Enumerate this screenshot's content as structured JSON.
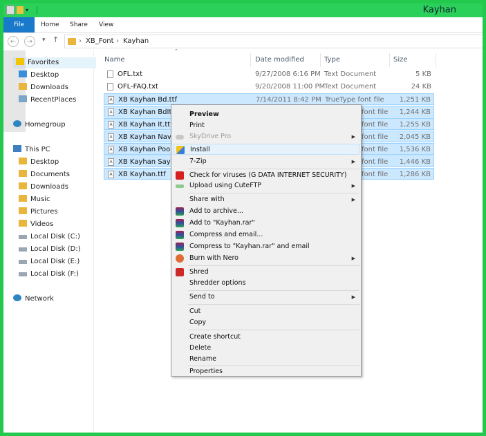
{
  "window": {
    "title": "Kayhan"
  },
  "ribbon": {
    "file": "File",
    "home": "Home",
    "share": "Share",
    "view": "View"
  },
  "address": {
    "part1": "XB_Font",
    "part2": "Kayhan",
    "sep": "›"
  },
  "sidebar": {
    "favorites": "Favorites",
    "desktop": "Desktop",
    "downloads": "Downloads",
    "recent": "RecentPlaces",
    "homegroup": "Homegroup",
    "thispc": "This PC",
    "pc_desktop": "Desktop",
    "documents": "Documents",
    "pc_downloads": "Downloads",
    "music": "Music",
    "pictures": "Pictures",
    "videos": "Videos",
    "disk_c": "Local Disk (C:)",
    "disk_d": "Local Disk (D:)",
    "disk_e": "Local Disk (E:)",
    "disk_f": "Local Disk (F:)",
    "network": "Network"
  },
  "columns": {
    "name": "Name",
    "date": "Date modified",
    "type": "Type",
    "size": "Size"
  },
  "files": [
    {
      "name": "OFL.txt",
      "date": "9/27/2008 6:16 PM",
      "type": "Text Document",
      "size": "5 KB"
    },
    {
      "name": "OFL-FAQ.txt",
      "date": "9/20/2008 11:00 PM",
      "type": "Text Document",
      "size": "24 KB"
    },
    {
      "name": "XB Kayhan Bd.ttf",
      "date": "7/14/2011 8:42 PM",
      "type": "TrueType font file",
      "size": "1,251 KB"
    },
    {
      "name": "XB Kayhan BdIt.ttf",
      "type": "font file",
      "size": "1,244 KB"
    },
    {
      "name": "XB Kayhan It.ttf",
      "type": "font file",
      "size": "1,255 KB"
    },
    {
      "name": "XB Kayhan Navaar",
      "type": "font file",
      "size": "2,045 KB"
    },
    {
      "name": "XB Kayhan Pook.tt",
      "type": "font file",
      "size": "1,536 KB"
    },
    {
      "name": "XB Kayhan Sayeh.",
      "type": "font file",
      "size": "1,446 KB"
    },
    {
      "name": "XB Kayhan.ttf",
      "type": "font file",
      "size": "1,286 KB"
    }
  ],
  "menu": {
    "preview": "Preview",
    "print": "Print",
    "skydrive": "SkyDrive Pro",
    "install": "Install",
    "zip": "7-Zip",
    "scan": "Check for viruses (G DATA INTERNET SECURITY)",
    "cuteftp": "Upload using CuteFTP",
    "share": "Share with",
    "archive": "Add to archive...",
    "rar": "Add to \"Kayhan.rar\"",
    "compress_email": "Compress and email...",
    "compress_rar_email": "Compress to \"Kayhan.rar\" and email",
    "nero": "Burn with Nero",
    "shred": "Shred",
    "shredder_opts": "Shredder options",
    "sendto": "Send to",
    "cut": "Cut",
    "copy": "Copy",
    "shortcut": "Create shortcut",
    "delete": "Delete",
    "rename": "Rename",
    "properties": "Properties",
    "arrow": "▶"
  }
}
